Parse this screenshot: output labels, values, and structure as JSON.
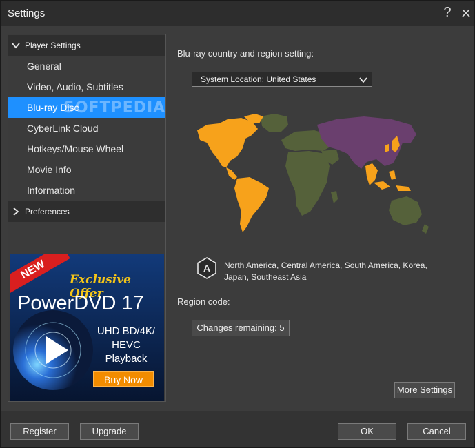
{
  "window": {
    "title": "Settings",
    "help_glyph": "?"
  },
  "nav": {
    "groups": [
      {
        "label": "Player Settings",
        "expanded": true,
        "items": [
          {
            "label": "General",
            "active": false
          },
          {
            "label": "Video, Audio, Subtitles",
            "active": false
          },
          {
            "label": "Blu-ray Disc",
            "active": true
          },
          {
            "label": "CyberLink Cloud",
            "active": false
          },
          {
            "label": "Hotkeys/Mouse Wheel",
            "active": false
          },
          {
            "label": "Movie Info",
            "active": false
          },
          {
            "label": "Information",
            "active": false
          }
        ]
      },
      {
        "label": "Preferences",
        "expanded": false,
        "items": []
      }
    ],
    "watermark": "SOFTPEDIA"
  },
  "promo": {
    "ribbon": "NEW",
    "offer": "Exclusive Offer",
    "product": "PowerDVD 17",
    "features": [
      "UHD BD/4K/",
      "HEVC",
      "Playback"
    ],
    "cta": "Buy Now"
  },
  "content": {
    "section_label": "Blu-ray country and region setting:",
    "location_select": {
      "value": "System Location: United States"
    },
    "region": {
      "letter": "A",
      "description": "North America, Central America, South America, Korea, Japan, Southeast Asia"
    },
    "region_code_label": "Region code:",
    "changes_button": "Changes remaining: 5",
    "more_settings_button": "More Settings"
  },
  "footer": {
    "register": "Register",
    "upgrade": "Upgrade",
    "ok": "OK",
    "cancel": "Cancel"
  },
  "colors": {
    "accent": "#1e90ff",
    "region_a": "#f7a21b",
    "region_b": "#55613a",
    "region_c": "#6a3f6e"
  }
}
